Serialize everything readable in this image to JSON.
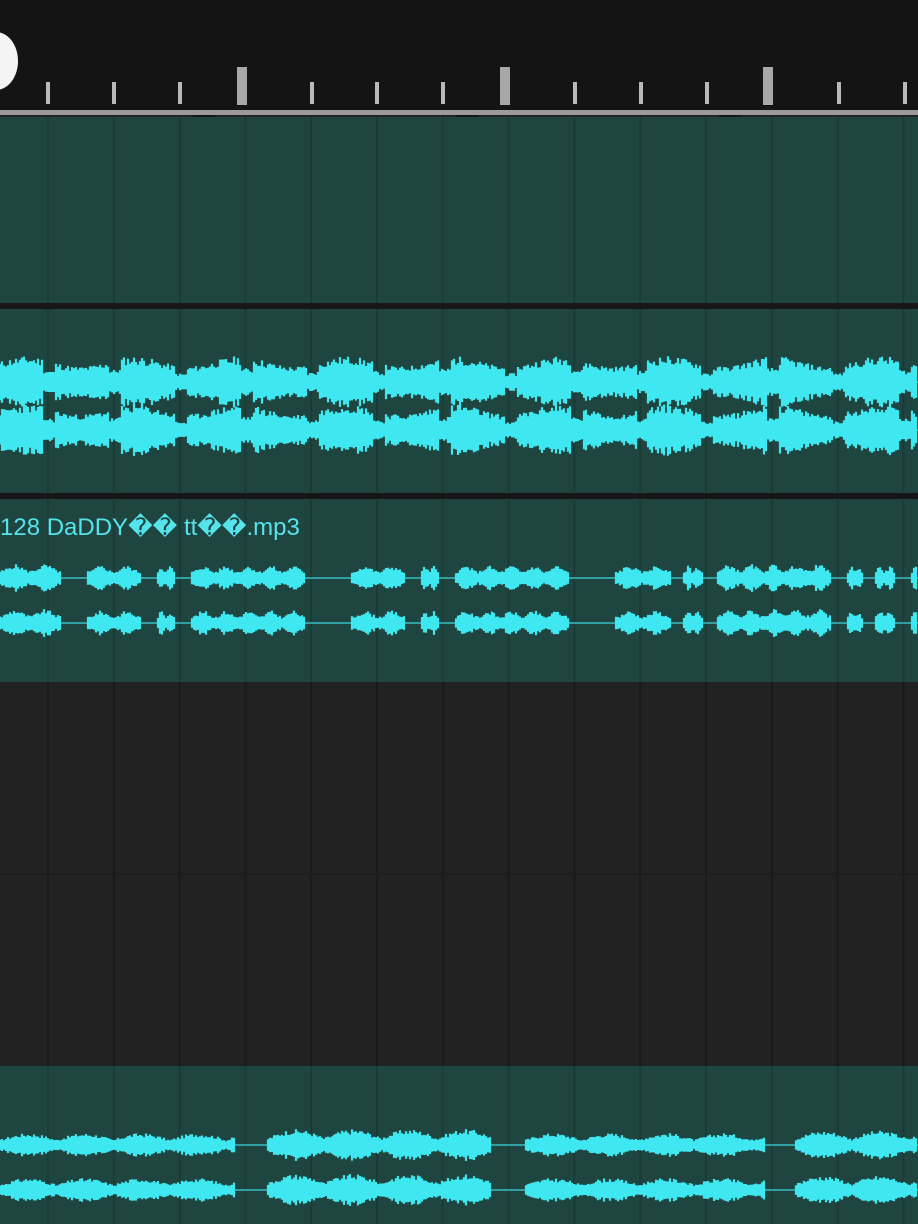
{
  "app": {
    "view": "multitrack-timeline"
  },
  "ruler": {
    "playhead_icon": "playhead-handle-icon",
    "marker_icon": "marker-triangle-icon"
  },
  "tracks": [
    {
      "id": "track-1",
      "state": "empty-clip",
      "label": ""
    },
    {
      "id": "track-2",
      "state": "audio-clip",
      "label": ""
    },
    {
      "id": "track-3",
      "state": "audio-clip",
      "label": "128 DaDDY�� tt��.mp3"
    },
    {
      "id": "track-4",
      "state": "empty",
      "label": ""
    },
    {
      "id": "track-5",
      "state": "audio-clip",
      "label": ""
    }
  ],
  "colors": {
    "waveform": "#3fe8f0",
    "clip_background": "#1f4540",
    "empty_background": "#222222",
    "ruler_background": "#141414",
    "label_text": "#56e4ec"
  }
}
